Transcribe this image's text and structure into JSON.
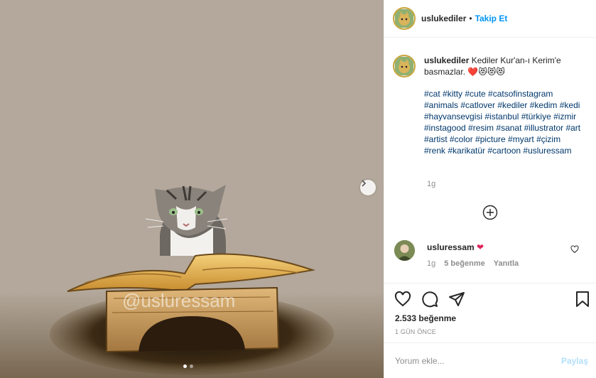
{
  "post": {
    "username": "uslukediler",
    "follow_sep": "•",
    "follow_label": "Takip Et",
    "caption_user": "uslukediler",
    "caption_text": "Kediler Kur'an-ı Kerim'e basmazlar.",
    "caption_emoji": "❤️😻😻😻",
    "hashtags": "#cat #kitty #cute #catsofinstagram #animals #catlover #kediler #kedim #kedi #hayvansevgisi #istanbul #türkiye #izmir #instagood #resim #sanat #illustrator #art #artist #color #picture #myart #çizim #renk #karikatür #cartoon #usluressam",
    "caption_time": "1g",
    "likes": "2.533 beğenme",
    "posted_ago": "1 GÜN ÖNCE",
    "watermark": "@usluressam"
  },
  "comment": {
    "user": "usluressam",
    "text": "❤",
    "time": "1g",
    "likes": "5 beğenme",
    "reply": "Yanıtla"
  },
  "add_comment": {
    "placeholder": "Yorum ekle...",
    "post_label": "Paylaş"
  },
  "icons": {
    "like": "heart-icon",
    "comment": "comment-icon",
    "share": "share-icon",
    "save": "bookmark-icon",
    "more_comments": "plus-circle-icon",
    "next": "chevron-right-icon"
  },
  "carousel": {
    "current": 1,
    "total": 2
  },
  "colors": {
    "accent": "#0095f6",
    "heart": "#e0245e",
    "hashtag": "#00376b",
    "muted": "#8e8e8e"
  }
}
